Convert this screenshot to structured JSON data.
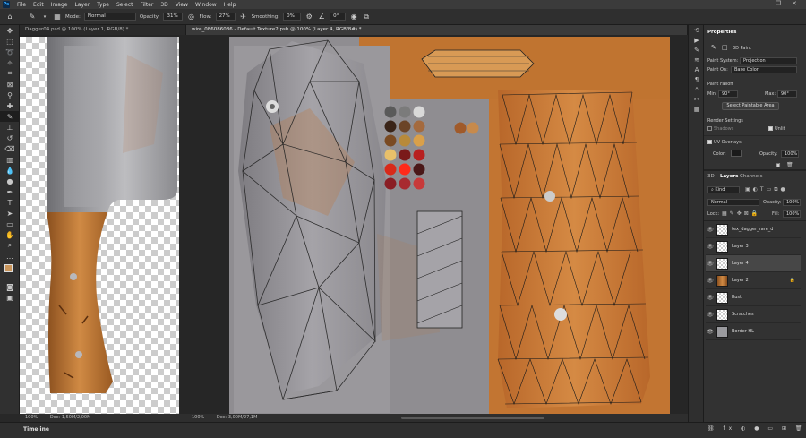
{
  "app": {
    "logo": "Ps"
  },
  "menu": [
    "File",
    "Edit",
    "Image",
    "Layer",
    "Type",
    "Select",
    "Filter",
    "3D",
    "View",
    "Window",
    "Help"
  ],
  "options": {
    "mode_label": "Mode:",
    "mode_value": "Normal",
    "opacity_label": "Opacity:",
    "opacity_value": "31%",
    "flow_label": "Flow:",
    "flow_value": "27%",
    "smoothing_label": "Smoothing:",
    "smoothing_value": "0%",
    "angle_value": "0°"
  },
  "documents": [
    {
      "tab": "Dagger04.psd @ 100% (Layer 1, RGB/8) *",
      "zoom": "100%",
      "doc_info": "Doc: 1,50M/2,00M"
    },
    {
      "tab": "wire_086086086 - Default Texture2.psb @ 100% (Layer 4, RGB/8#) *",
      "zoom": "100%",
      "doc_info": "Doc: 3,00M/27,1M"
    }
  ],
  "timeline": {
    "label": "Timeline"
  },
  "properties": {
    "tab": "Properties",
    "section": "3D Paint",
    "paint_system_label": "Paint System:",
    "paint_system_value": "Projection",
    "paint_on_label": "Paint On:",
    "paint_on_value": "Base Color",
    "falloff_label": "Paint Falloff",
    "min_label": "Min:",
    "min_value": "90°",
    "max_label": "Max:",
    "max_value": "90°",
    "select_btn": "Select Paintable Area",
    "render_label": "Render Settings",
    "shadows_label": "Shadows",
    "unlit_label": "Unlit",
    "uv_overlays_label": "UV Overlays",
    "color_label": "Color:",
    "uv_opacity_label": "Opacity:",
    "uv_opacity_value": "100%"
  },
  "layers_panel": {
    "tabs": [
      "3D",
      "Layers",
      "Channels"
    ],
    "kind_label": "Kind",
    "blend_mode": "Normal",
    "opacity_label": "Opacity:",
    "opacity_value": "100%",
    "lock_label": "Lock:",
    "fill_label": "Fill:",
    "fill_value": "100%",
    "layers": [
      {
        "name": "tex_dagger_rare_d"
      },
      {
        "name": "Layer 3"
      },
      {
        "name": "Layer 4"
      },
      {
        "name": "Layer 2"
      },
      {
        "name": "Rust"
      },
      {
        "name": "Scratches"
      },
      {
        "name": "Border HL"
      }
    ]
  },
  "swatches": [
    "#5a5a5a",
    "#7b7b7b",
    "#d9d9d9",
    "#3a2418",
    "#6b4427",
    "#a46a3e",
    "#a05a2a",
    "#c78a4c",
    "#7a4a22",
    "#b88a3a",
    "#d9a04a",
    "#e8c06a",
    "#7a1a1a",
    "#b82020",
    "#d82a1a",
    "#ff2a1a",
    "#4a1818",
    "#8a1e24",
    "#a82a30",
    "#c83a3a"
  ],
  "colors": {
    "accent": "#31a8ff",
    "panel": "#323232",
    "background": "#282828"
  }
}
